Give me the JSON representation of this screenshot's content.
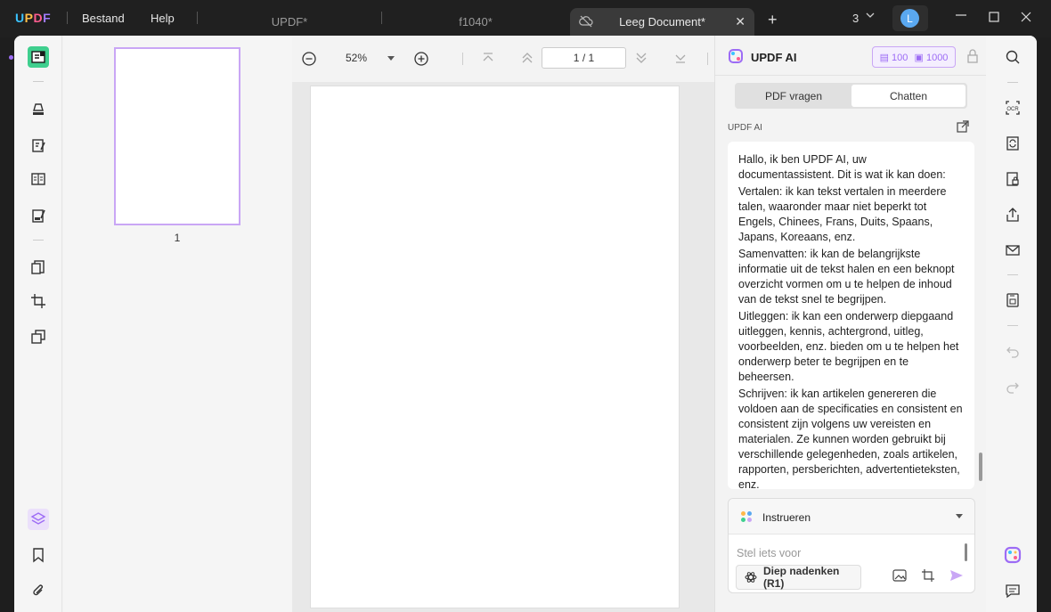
{
  "titlebar": {
    "logo": "UPDF",
    "menu": [
      "Bestand",
      "Help"
    ],
    "tabs": [
      {
        "label": "UPDF*",
        "active": false
      },
      {
        "label": "f1040*",
        "active": false
      },
      {
        "label": "Leeg Document*",
        "active": true
      }
    ],
    "window_count": "3",
    "avatar_letter": "L"
  },
  "thumbnails": {
    "page_number": "1"
  },
  "viewer": {
    "zoom": "52%",
    "page_current": "1",
    "page_sep": "/",
    "page_total": "1"
  },
  "ai_panel": {
    "title": "UPDF AI",
    "credits_a": "100",
    "credits_b": "1000",
    "tabs": [
      "PDF vragen",
      "Chatten"
    ],
    "active_tab": "Chatten",
    "sender_label": "UPDF AI",
    "message": [
      "Hallo, ik ben UPDF AI, uw documentassistent. Dit is wat ik kan doen:",
      "Vertalen: ik kan tekst vertalen in meerdere talen, waaronder maar niet beperkt tot Engels, Chinees, Frans, Duits, Spaans, Japans, Koreaans, enz.",
      "Samenvatten: ik kan de belangrijkste informatie uit de tekst halen en een beknopt overzicht vormen om u te helpen de inhoud van de tekst snel te begrijpen.",
      "Uitleggen: ik kan een onderwerp diepgaand uitleggen, kennis, achtergrond, uitleg, voorbeelden, enz. bieden om u te helpen het onderwerp beter te begrijpen en te beheersen.",
      "Schrijven: ik kan artikelen genereren die voldoen aan de specificaties en consistent en consistent zijn volgens uw vereisten en materialen. Ze kunnen worden gebruikt bij verschillende gelegenheden, zoals artikelen, rapporten, persberichten, advertentieteksten, enz."
    ],
    "prompt_mode": "Instrueren",
    "input_placeholder": "Stel iets voor",
    "deep_think_label": "Diep nadenken (R1)"
  },
  "colors": {
    "accent": "#9d6cf5",
    "tool_selected": "#3fcf8e"
  }
}
